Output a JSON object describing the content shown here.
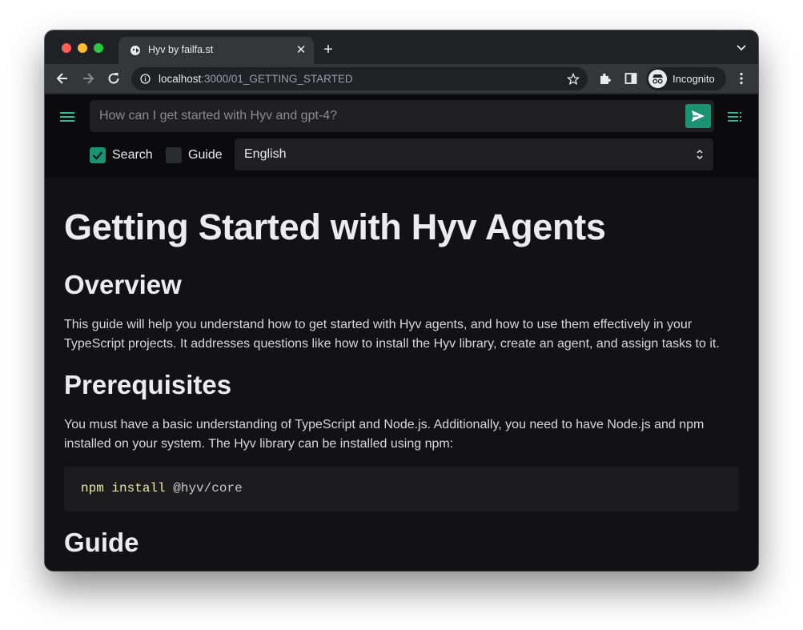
{
  "browser": {
    "tab_title": "Hyv by failfa.st",
    "url_host": "localhost",
    "url_path": ":3000/01_GETTING_STARTED",
    "profile_label": "Incognito"
  },
  "app": {
    "ask_placeholder": "How can I get started with Hyv and gpt-4?",
    "options": {
      "search_label": "Search",
      "search_checked": true,
      "guide_label": "Guide",
      "guide_checked": false
    },
    "language": "English",
    "accent_color": "#1b9373"
  },
  "doc": {
    "title": "Getting Started with Hyv Agents",
    "sections": [
      {
        "heading": "Overview",
        "body": "This guide will help you understand how to get started with Hyv agents, and how to use them effectively in your TypeScript projects. It addresses questions like how to install the Hyv library, create an agent, and assign tasks to it."
      },
      {
        "heading": "Prerequisites",
        "body": "You must have a basic understanding of TypeScript and Node.js. Additionally, you need to have Node.js and npm installed on your system. The Hyv library can be installed using npm:"
      },
      {
        "heading": "Guide"
      }
    ],
    "code": {
      "cmd1": "npm",
      "cmd2": "install",
      "arg": "@hyv/core"
    }
  }
}
